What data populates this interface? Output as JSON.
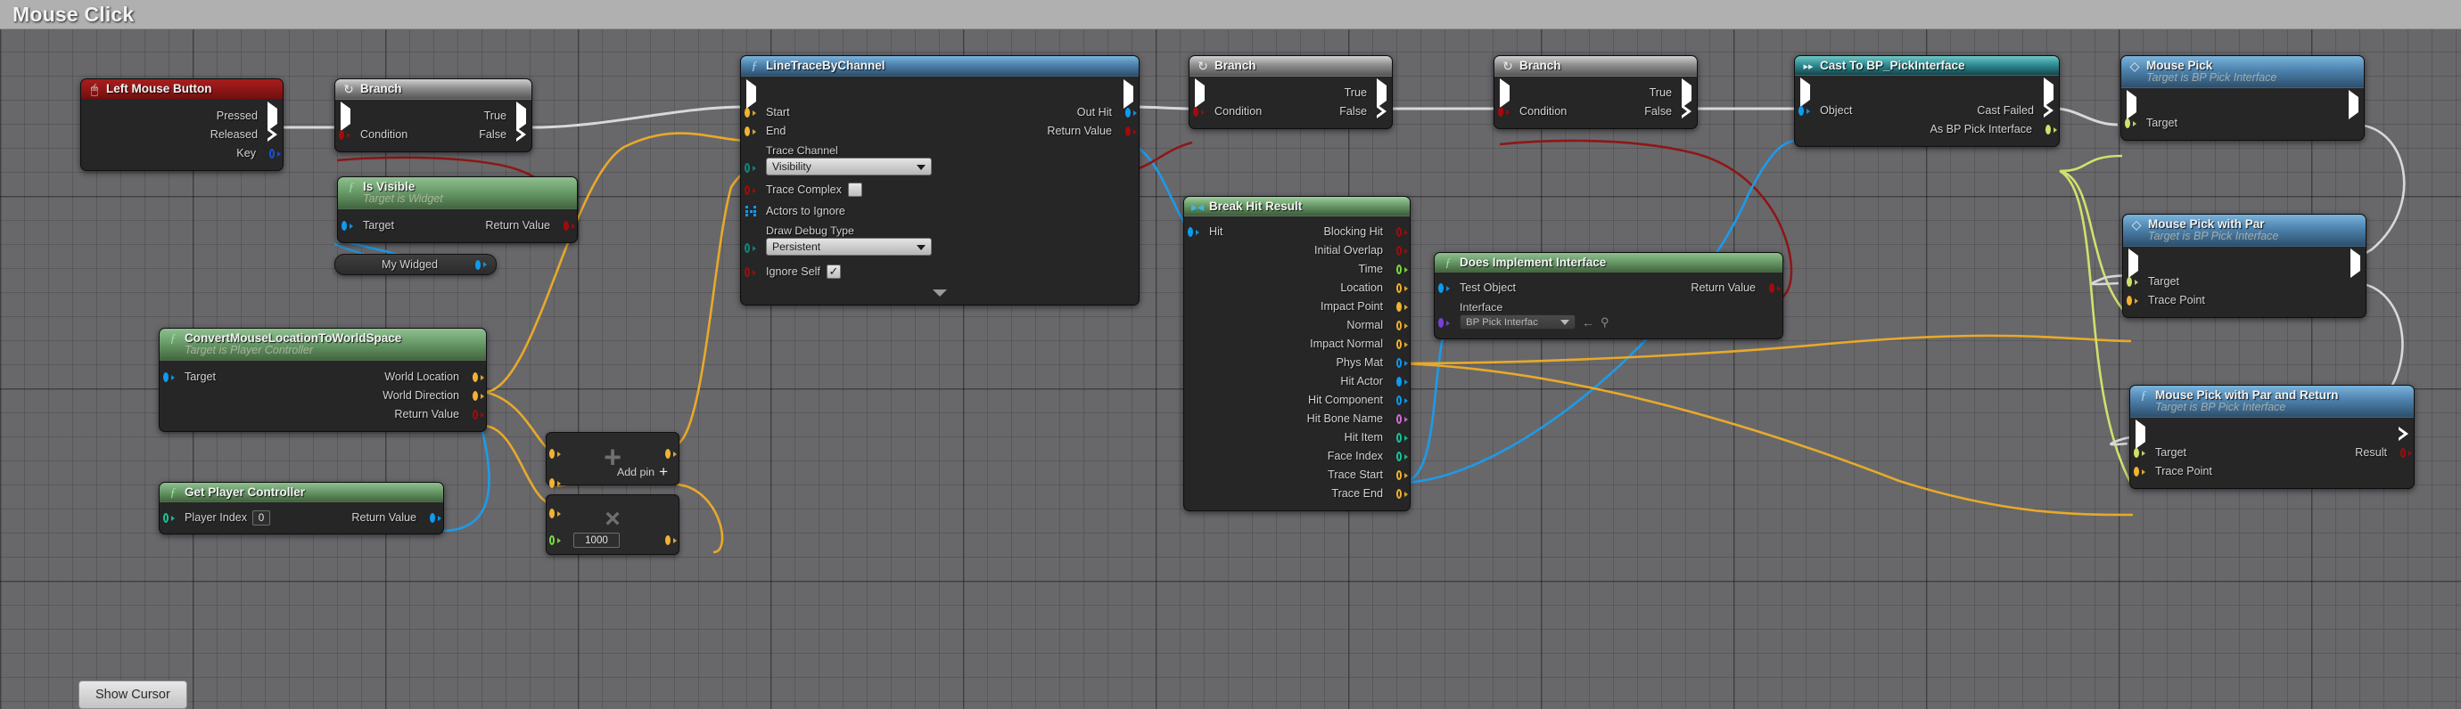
{
  "comment": {
    "title": "Mouse Click"
  },
  "bottom": {
    "show_cursor": "Show Cursor"
  },
  "colors": {
    "exec": "#ffffff",
    "bool": "#a30b0b",
    "vector": "#f2b233",
    "object": "#0e9bf0",
    "struct": "#0e5ff0",
    "float": "#7bdf3e",
    "int": "#16c79a",
    "name": "#cf6fd8",
    "byte": "#0d8a7e",
    "class": "#7a3fd8",
    "interface": "#d2e06b",
    "canvas_bg": "#68686b",
    "node_bg": "#262626"
  },
  "nodes": {
    "left_mouse_button": {
      "title": "Left Mouse Button",
      "icon": "mouse-icon",
      "pins": {
        "pressed": "Pressed",
        "released": "Released",
        "key": "Key"
      }
    },
    "branch1": {
      "title": "Branch",
      "icon": "branch-icon",
      "pins": {
        "condition": "Condition",
        "true": "True",
        "false": "False"
      }
    },
    "is_visible": {
      "title": "Is Visible",
      "subtitle": "Target is Widget",
      "icon": "function-icon",
      "pins": {
        "target": "Target",
        "return_value": "Return Value"
      }
    },
    "my_widged": {
      "title": "My Widged",
      "icon": "variable-icon"
    },
    "convert_mouse": {
      "title": "ConvertMouseLocationToWorldSpace",
      "subtitle": "Target is Player Controller",
      "icon": "function-icon",
      "pins": {
        "target": "Target",
        "world_location": "World Location",
        "world_direction": "World Direction",
        "return_value": "Return Value"
      }
    },
    "get_player_controller": {
      "title": "Get Player Controller",
      "icon": "function-icon",
      "pins": {
        "player_index": "Player Index",
        "return_value": "Return Value"
      },
      "values": {
        "player_index": "0"
      }
    },
    "add_node": {
      "glyph": "+",
      "add_pin_label": "Add pin",
      "add_pin_glyph": "+"
    },
    "multiply_node": {
      "glyph": "×",
      "value": "1000"
    },
    "line_trace": {
      "title": "LineTraceByChannel",
      "icon": "function-icon",
      "pins": {
        "start": "Start",
        "end": "End",
        "trace_channel": "Trace Channel",
        "trace_complex": "Trace Complex",
        "actors_to_ignore": "Actors to Ignore",
        "draw_debug_type": "Draw Debug Type",
        "ignore_self": "Ignore Self",
        "out_hit": "Out Hit",
        "return_value": "Return Value"
      },
      "values": {
        "trace_channel": "Visibility",
        "draw_debug_type": "Persistent",
        "trace_complex": false,
        "ignore_self": true
      }
    },
    "branch2": {
      "title": "Branch",
      "icon": "branch-icon",
      "pins": {
        "condition": "Condition",
        "true": "True",
        "false": "False"
      }
    },
    "branch3": {
      "title": "Branch",
      "icon": "branch-icon",
      "pins": {
        "condition": "Condition",
        "true": "True",
        "false": "False"
      }
    },
    "break_hit_result": {
      "title": "Break Hit Result",
      "icon": "break-icon",
      "pins": {
        "hit": "Hit",
        "blocking_hit": "Blocking Hit",
        "initial_overlap": "Initial Overlap",
        "time": "Time",
        "location": "Location",
        "impact_point": "Impact Point",
        "normal": "Normal",
        "impact_normal": "Impact Normal",
        "phys_mat": "Phys Mat",
        "hit_actor": "Hit Actor",
        "hit_component": "Hit Component",
        "hit_bone_name": "Hit Bone Name",
        "hit_item": "Hit Item",
        "face_index": "Face Index",
        "trace_start": "Trace Start",
        "trace_end": "Trace End"
      }
    },
    "does_implement_interface": {
      "title": "Does Implement Interface",
      "icon": "function-icon",
      "pins": {
        "test_object": "Test Object",
        "interface": "Interface",
        "return_value": "Return Value"
      },
      "values": {
        "interface": "BP Pick Interfac"
      }
    },
    "cast_to_bp_pickinterface": {
      "title": "Cast To BP_PickInterface",
      "icon": "cast-icon",
      "pins": {
        "object": "Object",
        "cast_failed": "Cast Failed",
        "as_bp_pick_interface": "As BP Pick Interface"
      }
    },
    "mouse_pick": {
      "title": "Mouse Pick",
      "subtitle": "Target is BP Pick Interface",
      "icon": "interface-message-icon",
      "pins": {
        "target": "Target"
      }
    },
    "mouse_pick_with_par": {
      "title": "Mouse Pick with Par",
      "subtitle": "Target is BP Pick Interface",
      "icon": "interface-message-icon",
      "pins": {
        "target": "Target",
        "trace_point": "Trace Point"
      }
    },
    "mouse_pick_with_par_and_return": {
      "title": "Mouse Pick with Par and Return",
      "subtitle": "Target is BP Pick Interface",
      "icon": "function-icon",
      "pins": {
        "target": "Target",
        "trace_point": "Trace Point",
        "result": "Result"
      }
    }
  }
}
